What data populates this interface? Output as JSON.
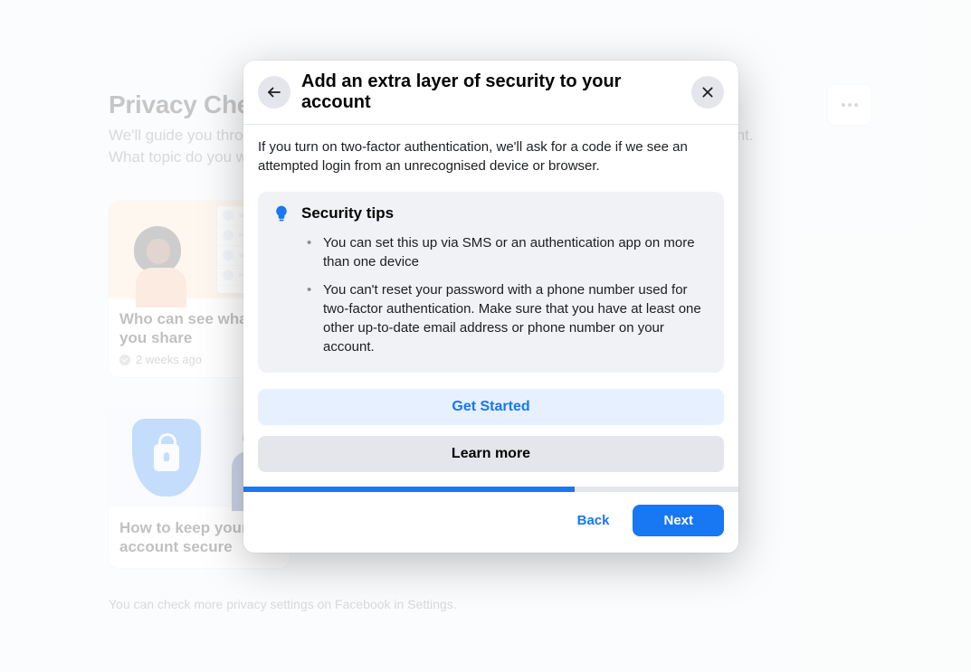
{
  "page": {
    "title": "Privacy Checkup",
    "subtitle": "We'll guide you through some settings so that you can make the right choices for your account. What topic do you want to start with?",
    "footnote": "You can check more privacy settings on Facebook in Settings."
  },
  "cards": [
    {
      "title": "Who can see what you share",
      "meta_label": "2 weeks ago"
    },
    {
      "title": "How to keep your account secure",
      "meta_label": ""
    }
  ],
  "dialog": {
    "title": "Add an extra layer of security to your account",
    "intro": "If you turn on two-factor authentication, we'll ask for a code if we see an attempted login from an unrecognised device or browser.",
    "tips_heading": "Security tips",
    "tips": [
      "You can set this up via SMS or an authentication app on more than one device",
      "You can't reset your password with a phone number used for two-factor authentication. Make sure that you have at least one other up-to-date email address or phone number on your account."
    ],
    "cta_primary": "Get Started",
    "cta_secondary": "Learn more",
    "footer_back": "Back",
    "footer_next": "Next",
    "progress_percent": 67
  }
}
